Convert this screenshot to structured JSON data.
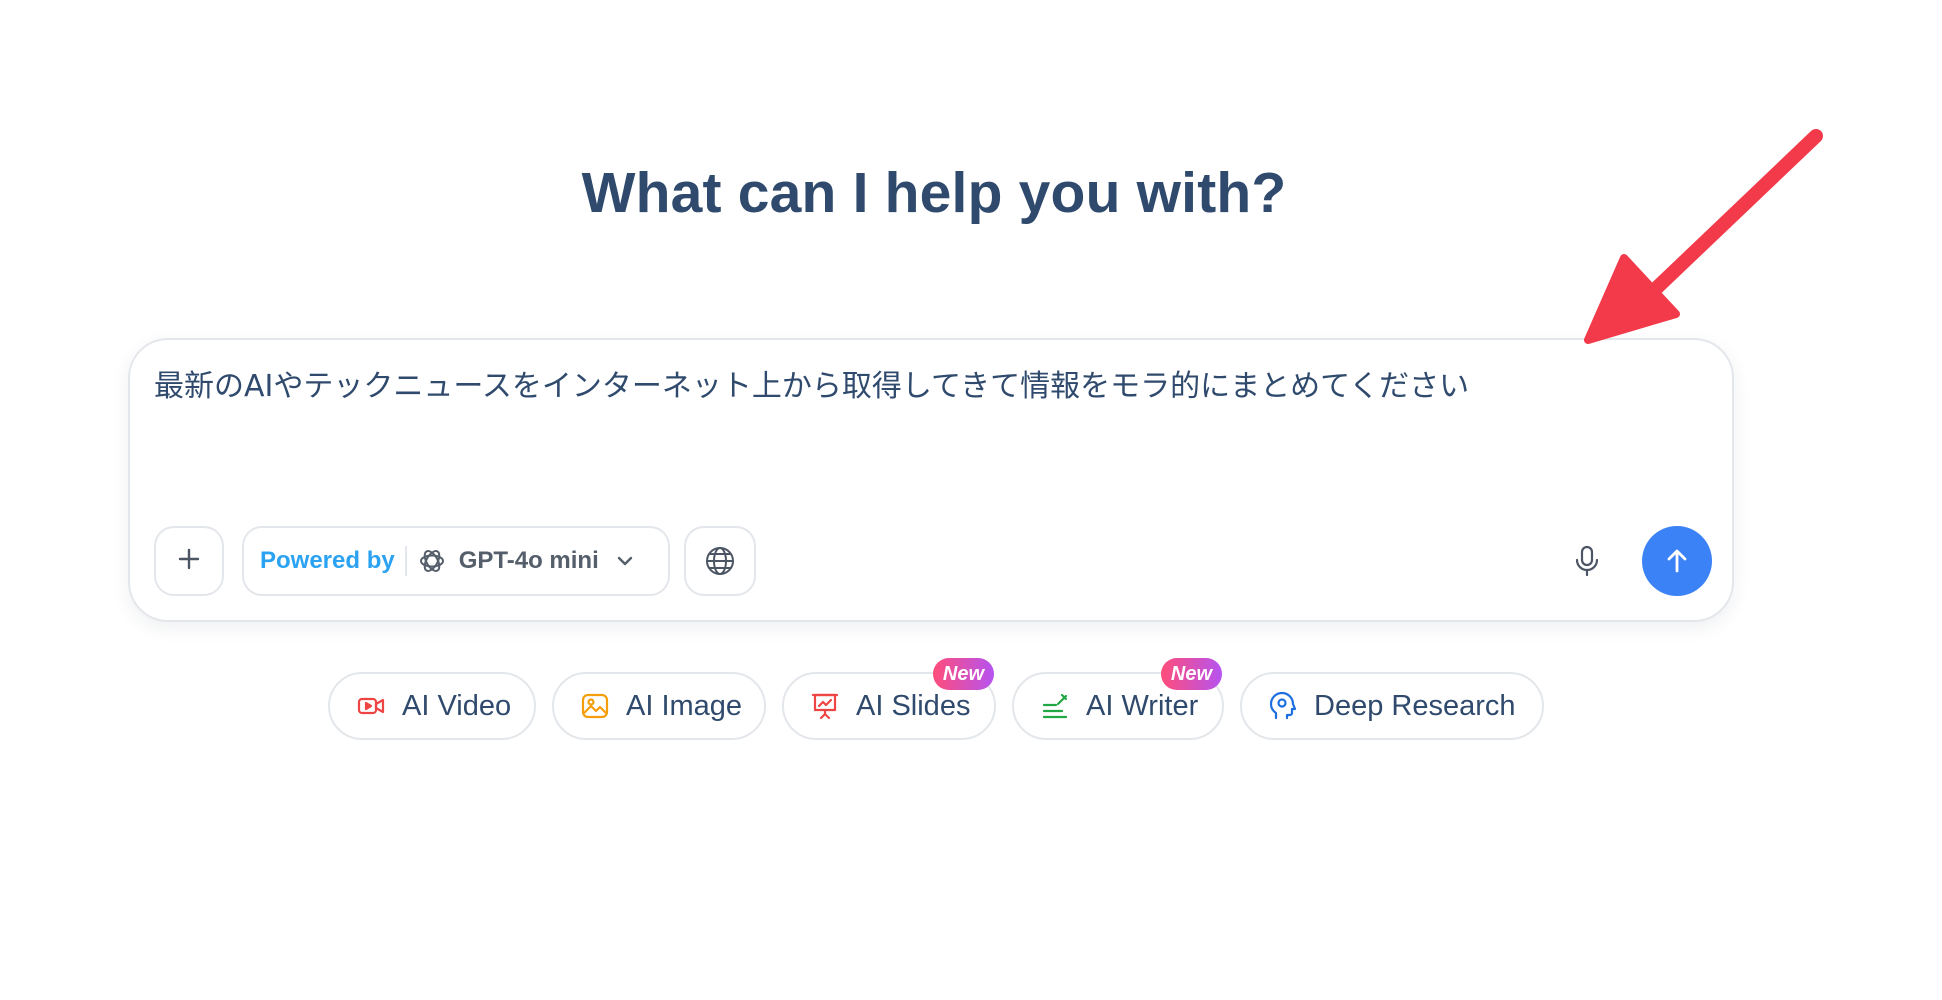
{
  "headline": "What can I help you with?",
  "composer": {
    "prompt_text": "最新のAIやテックニュースをインターネット上から取得してきて情報をモラ的にまとめてください",
    "model_selector": {
      "powered_label": "Powered by",
      "model_name": "GPT-4o mini",
      "model_icon": "openai-logo-icon",
      "dropdown_icon": "chevron-down-icon"
    },
    "add_button_icon": "plus-icon",
    "web_search_icon": "globe-icon",
    "mic_icon": "microphone-icon",
    "send_icon": "arrow-up-icon"
  },
  "quick_actions": [
    {
      "label": "AI Video",
      "icon": "video-icon",
      "icon_color": "#ef4444",
      "badge": ""
    },
    {
      "label": "AI Image",
      "icon": "image-icon",
      "icon_color": "#f59e0b",
      "badge": ""
    },
    {
      "label": "AI Slides",
      "icon": "presentation-icon",
      "icon_color": "#ef4444",
      "badge": "New"
    },
    {
      "label": "AI Writer",
      "icon": "writer-icon",
      "icon_color": "#22a745",
      "badge": "New"
    },
    {
      "label": "Deep Research",
      "icon": "research-icon",
      "icon_color": "#1d6fe0",
      "badge": ""
    }
  ],
  "colors": {
    "headline": "#2f4a6d",
    "accent_blue": "#3b82f6",
    "powered_by": "#2ba3f2",
    "annotation_arrow": "#f23a4a",
    "badge_gradient_start": "#ff4d7a",
    "badge_gradient_end": "#b653f0"
  },
  "annotation": {
    "arrow_icon": "red-pointer-arrow-icon"
  }
}
